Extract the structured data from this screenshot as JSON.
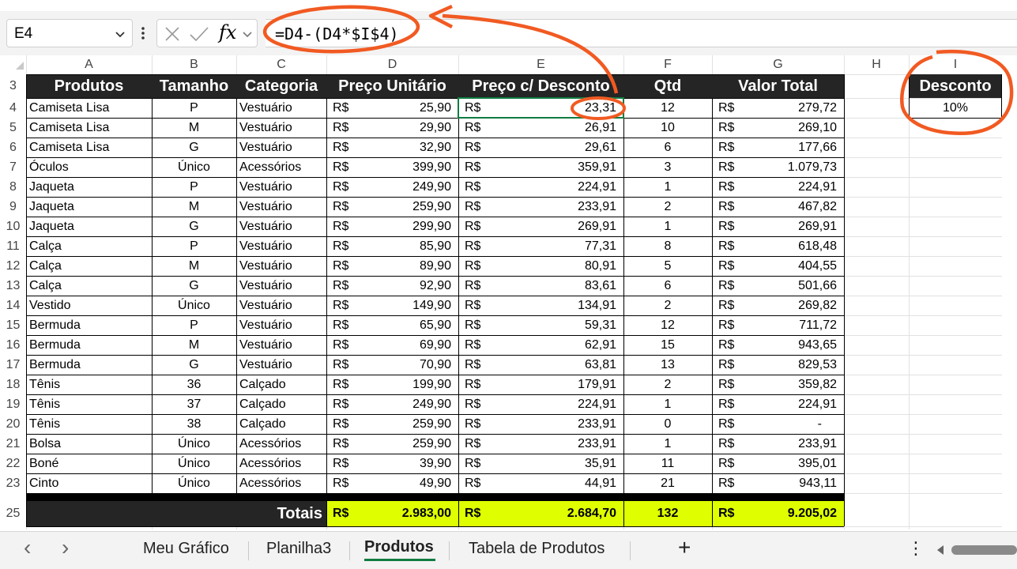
{
  "formula_bar": {
    "name_box": "E4",
    "fx_label": "fx",
    "formula": "=D4-(D4*$I$4)"
  },
  "columns": [
    "A",
    "B",
    "C",
    "D",
    "E",
    "F",
    "G",
    "H",
    "I"
  ],
  "row_numbers": [
    "3",
    "4",
    "5",
    "6",
    "7",
    "8",
    "9",
    "10",
    "11",
    "12",
    "13",
    "14",
    "15",
    "16",
    "17",
    "18",
    "19",
    "20",
    "21",
    "22",
    "23",
    "25"
  ],
  "table": {
    "headers": [
      "Produtos",
      "Tamanho",
      "Categoria",
      "Preço Unitário",
      "Preço c/ Desconto",
      "Qtd",
      "Valor Total"
    ],
    "currency": "R$",
    "rows": [
      [
        "Camiseta Lisa",
        "P",
        "Vestuário",
        "25,90",
        "23,31",
        "12",
        "279,72"
      ],
      [
        "Camiseta Lisa",
        "M",
        "Vestuário",
        "29,90",
        "26,91",
        "10",
        "269,10"
      ],
      [
        "Camiseta Lisa",
        "G",
        "Vestuário",
        "32,90",
        "29,61",
        "6",
        "177,66"
      ],
      [
        "Óculos",
        "Único",
        "Acessórios",
        "399,90",
        "359,91",
        "3",
        "1.079,73"
      ],
      [
        "Jaqueta",
        "P",
        "Vestuário",
        "249,90",
        "224,91",
        "1",
        "224,91"
      ],
      [
        "Jaqueta",
        "M",
        "Vestuário",
        "259,90",
        "233,91",
        "2",
        "467,82"
      ],
      [
        "Jaqueta",
        "G",
        "Vestuário",
        "299,90",
        "269,91",
        "1",
        "269,91"
      ],
      [
        "Calça",
        "P",
        "Vestuário",
        "85,90",
        "77,31",
        "8",
        "618,48"
      ],
      [
        "Calça",
        "M",
        "Vestuário",
        "89,90",
        "80,91",
        "5",
        "404,55"
      ],
      [
        "Calça",
        "G",
        "Vestuário",
        "92,90",
        "83,61",
        "6",
        "501,66"
      ],
      [
        "Vestido",
        "Único",
        "Vestuário",
        "149,90",
        "134,91",
        "2",
        "269,82"
      ],
      [
        "Bermuda",
        "P",
        "Vestuário",
        "65,90",
        "59,31",
        "12",
        "711,72"
      ],
      [
        "Bermuda",
        "M",
        "Vestuário",
        "69,90",
        "62,91",
        "15",
        "943,65"
      ],
      [
        "Bermuda",
        "G",
        "Vestuário",
        "70,90",
        "63,81",
        "13",
        "829,53"
      ],
      [
        "Tênis",
        "36",
        "Calçado",
        "199,90",
        "179,91",
        "2",
        "359,82"
      ],
      [
        "Tênis",
        "37",
        "Calçado",
        "249,90",
        "224,91",
        "1",
        "224,91"
      ],
      [
        "Tênis",
        "38",
        "Calçado",
        "259,90",
        "233,91",
        "0",
        "-"
      ],
      [
        "Bolsa",
        "Único",
        "Acessórios",
        "259,90",
        "233,91",
        "1",
        "233,91"
      ],
      [
        "Boné",
        "Único",
        "Acessórios",
        "39,90",
        "35,91",
        "11",
        "395,01"
      ],
      [
        "Cinto",
        "Único",
        "Acessórios",
        "49,90",
        "44,91",
        "21",
        "943,11"
      ]
    ],
    "totals": {
      "label": "Totais",
      "currency": "R$",
      "preco_unitario": "2.983,00",
      "preco_desconto": "2.684,70",
      "qtd": "132",
      "valor_total": "9.205,02"
    }
  },
  "discount": {
    "header": "Desconto",
    "value": "10%"
  },
  "sheet_tabs": {
    "tabs": [
      "Meu Gráfico",
      "Planilha3",
      "Produtos",
      "Tabela de Produtos"
    ],
    "active": "Produtos",
    "add_label": "+",
    "prev_icon": "‹",
    "next_icon": "›",
    "more_icon": "⋮"
  },
  "colors": {
    "header_bg": "#252525",
    "totals_bg": "#dfff00",
    "annotation": "#f15a22",
    "active_tab_accent": "#107c41"
  }
}
